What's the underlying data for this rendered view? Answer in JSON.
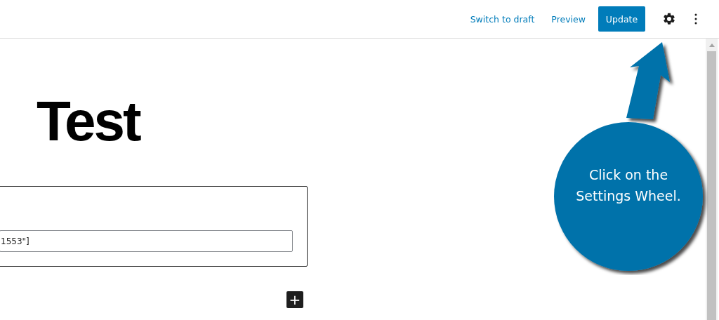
{
  "header": {
    "links": [
      "Switch to draft",
      "Preview"
    ],
    "primary_button": "Update",
    "icons": [
      {
        "kind": "gear"
      },
      {
        "kind": "more"
      }
    ]
  },
  "post": {
    "title": "Test",
    "shortcode_field": {
      "value": "1553\"]"
    },
    "add_block": "+"
  },
  "callout": {
    "text": "Click on the Settings Wheel."
  }
}
